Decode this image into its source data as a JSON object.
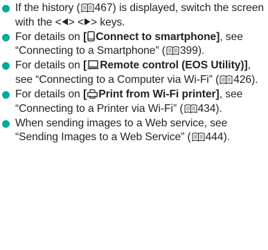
{
  "items": [
    {
      "t1": "If the history (",
      "p1": "467",
      "t2": ") is displayed, switch the screen with the <",
      "t3": "> <",
      "t4": "> keys."
    },
    {
      "t1": "For details on ",
      "b1": "[",
      "b2": "Connect to smartphone]",
      "t2": ", see “Connecting to a Smartphone” (",
      "p1": "399",
      "t3": ")."
    },
    {
      "t1": "For details on ",
      "b1": "[",
      "b2": "Remote control (EOS Utility)]",
      "t2": ", see “Connecting to a Computer via Wi-Fi” (",
      "p1": "426",
      "t3": ")."
    },
    {
      "t1": "For details on ",
      "b1": "[",
      "b2": "Print from Wi-Fi printer]",
      "t2": ", see “Connecting to a Printer via Wi-Fi” (",
      "p1": "434",
      "t3": ")."
    },
    {
      "t1": "When sending images to a Web service, see “Sending Images to a Web Service” (",
      "p1": "444",
      "t2": ")."
    }
  ],
  "icons": {
    "bullet_color": "#00a99d",
    "page_ref": "book-icon",
    "left_key": "left-arrow-key-icon",
    "right_key": "right-arrow-key-icon",
    "smartphone": "smartphone-icon",
    "computer": "computer-icon",
    "printer": "printer-icon"
  }
}
